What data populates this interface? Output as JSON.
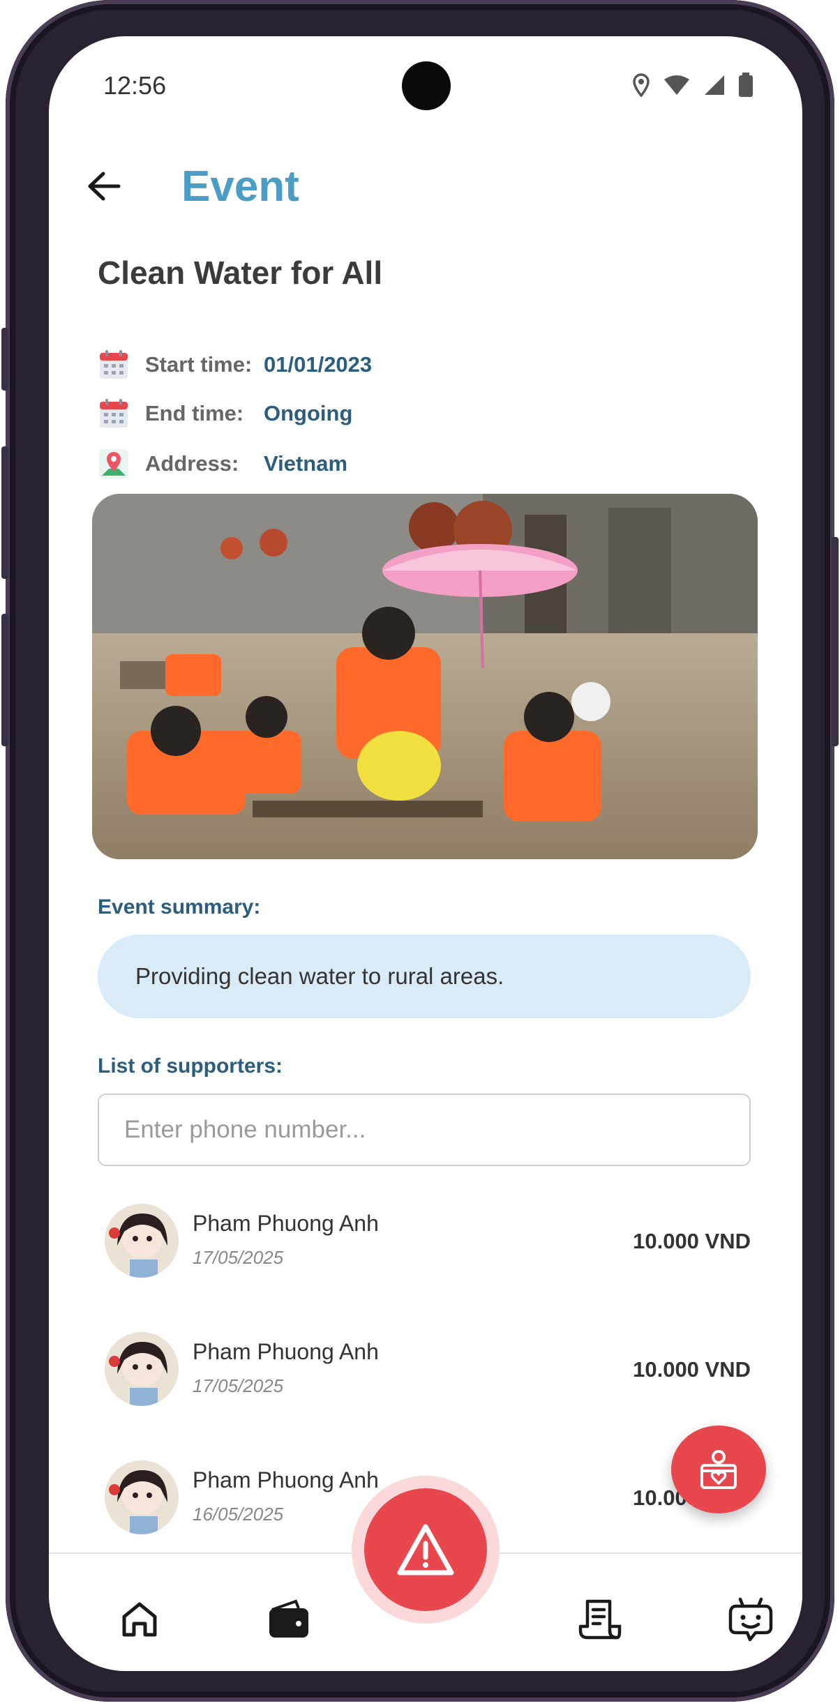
{
  "status_bar": {
    "time": "12:56"
  },
  "header": {
    "title": "Event"
  },
  "event": {
    "name": "Clean Water for All",
    "start_label": "Start time:",
    "start_value": "01/01/2023",
    "end_label": "End time:",
    "end_value": "Ongoing",
    "address_label": "Address:",
    "address_value": "Vietnam"
  },
  "summary": {
    "label": "Event summary:",
    "text": "Providing clean water to rural areas."
  },
  "supporters": {
    "label": "List of supporters:",
    "search_placeholder": "Enter phone number...",
    "items": [
      {
        "name": "Pham Phuong Anh",
        "date": "17/05/2025",
        "amount": "10.000 VND"
      },
      {
        "name": "Pham Phuong Anh",
        "date": "17/05/2025",
        "amount": "10.000 VND"
      },
      {
        "name": "Pham Phuong Anh",
        "date": "16/05/2025",
        "amount": "10.000 VND"
      }
    ]
  },
  "nav": {
    "items": [
      "home-icon",
      "wallet-icon",
      "alert-icon",
      "receipt-icon",
      "chatbot-icon"
    ]
  },
  "colors": {
    "accent": "#4b9cc6",
    "value_text": "#2b5d7e",
    "summary_bg": "#d9ebf6",
    "danger": "#e8474e"
  }
}
